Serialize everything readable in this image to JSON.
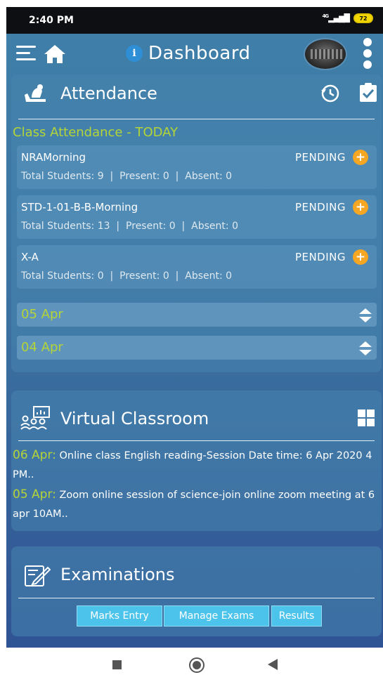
{
  "status_bar": {
    "time": "2:40 PM",
    "network": "4G",
    "battery": "72"
  },
  "app_bar": {
    "title": "Dashboard"
  },
  "attendance": {
    "title": "Attendance",
    "subtitle": "Class Attendance - TODAY",
    "classes": [
      {
        "name": "NRAMorning",
        "status": "PENDING",
        "stats": "Total Students: 9  |  Present: 0  |  Absent: 0"
      },
      {
        "name": "STD-1-01-B-B-Morning",
        "status": "PENDING",
        "stats": "Total Students: 13  |  Present: 0  |  Absent: 0"
      },
      {
        "name": "X-A",
        "status": "PENDING",
        "stats": "Total Students: 0  |  Present: 0  |  Absent: 0"
      }
    ],
    "dates": [
      "05 Apr",
      "04 Apr"
    ]
  },
  "virtual_classroom": {
    "title": "Virtual Classroom",
    "items": [
      {
        "date": "06 Apr:",
        "text": " Online class English reading-Session Date time: 6 Apr 2020 4 PM.."
      },
      {
        "date": "05 Apr:",
        "text": " Zoom online session of science-join online zoom meeting at 6 apr 10AM.."
      }
    ]
  },
  "examinations": {
    "title": "Examinations",
    "buttons": [
      "Marks Entry",
      "Manage Exams",
      "Results"
    ]
  },
  "colors": {
    "accent_green": "#b4d437",
    "pending_orange": "#f5a623",
    "button_blue": "#4cc3ea"
  }
}
